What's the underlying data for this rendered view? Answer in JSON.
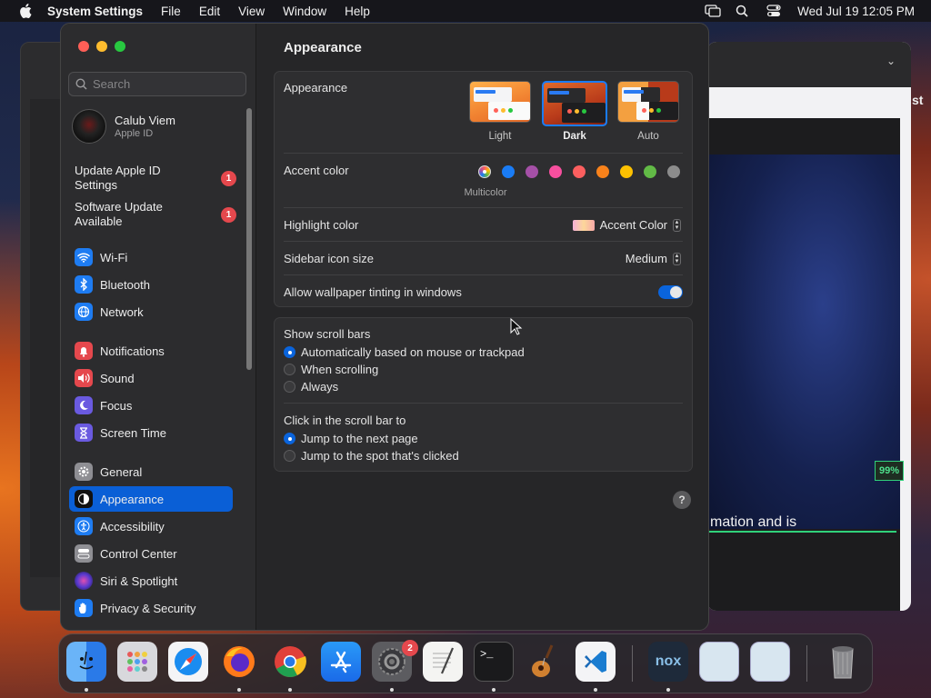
{
  "menubar": {
    "app": "System Settings",
    "menus": [
      "File",
      "Edit",
      "View",
      "Window",
      "Help"
    ],
    "datetime": "Wed Jul 19  12:05 PM"
  },
  "background": {
    "progress_label": "99%",
    "progress": 0.99,
    "partial_text": "mation and is",
    "corner_text": "st"
  },
  "sidebar": {
    "search_placeholder": "Search",
    "profile": {
      "name": "Calub Viem",
      "sub": "Apple ID"
    },
    "notices": [
      {
        "label": "Update Apple ID Settings",
        "badge": "1"
      },
      {
        "label": "Software Update Available",
        "badge": "1"
      }
    ],
    "items": [
      {
        "label": "Wi-Fi",
        "icon": "wifi-icon",
        "color": "#1e7cf2"
      },
      {
        "label": "Bluetooth",
        "icon": "bluetooth-icon",
        "color": "#1e7cf2"
      },
      {
        "label": "Network",
        "icon": "globe-icon",
        "color": "#1e7cf2"
      },
      {
        "label": "Notifications",
        "icon": "bell-icon",
        "color": "#e5484d"
      },
      {
        "label": "Sound",
        "icon": "speaker-icon",
        "color": "#e5484d"
      },
      {
        "label": "Focus",
        "icon": "moon-icon",
        "color": "#6a5ae0"
      },
      {
        "label": "Screen Time",
        "icon": "hourglass-icon",
        "color": "#6a5ae0"
      },
      {
        "label": "General",
        "icon": "gear-icon",
        "color": "#8e8e93"
      },
      {
        "label": "Appearance",
        "icon": "appearance-icon",
        "color": "#111111",
        "selected": true
      },
      {
        "label": "Accessibility",
        "icon": "accessibility-icon",
        "color": "#1e7cf2"
      },
      {
        "label": "Control Center",
        "icon": "control-center-icon",
        "color": "#8e8e93"
      },
      {
        "label": "Siri & Spotlight",
        "icon": "siri-icon",
        "color": "#3a2a6a"
      },
      {
        "label": "Privacy & Security",
        "icon": "hand-icon",
        "color": "#1e7cf2"
      }
    ]
  },
  "content": {
    "title": "Appearance",
    "appearance": {
      "label": "Appearance",
      "options": [
        {
          "label": "Light",
          "selected": false
        },
        {
          "label": "Dark",
          "selected": true
        },
        {
          "label": "Auto",
          "selected": false
        }
      ]
    },
    "accent": {
      "label": "Accent color",
      "caption": "Multicolor",
      "colors": [
        "multicolor",
        "#1a7cf5",
        "#a550a7",
        "#f74f9e",
        "#fc5f5f",
        "#f8821b",
        "#fdc101",
        "#62ba46",
        "#8c8c8c"
      ],
      "selected": "multicolor"
    },
    "highlight": {
      "label": "Highlight color",
      "value": "Accent Color"
    },
    "icon_size": {
      "label": "Sidebar icon size",
      "value": "Medium"
    },
    "tinting": {
      "label": "Allow wallpaper tinting in windows",
      "on": true
    },
    "scroll_bars": {
      "label": "Show scroll bars",
      "options": [
        {
          "label": "Automatically based on mouse or trackpad",
          "selected": true
        },
        {
          "label": "When scrolling",
          "selected": false
        },
        {
          "label": "Always",
          "selected": false
        }
      ]
    },
    "click_scroll": {
      "label": "Click in the scroll bar to",
      "options": [
        {
          "label": "Jump to the next page",
          "selected": true
        },
        {
          "label": "Jump to the spot that's clicked",
          "selected": false
        }
      ]
    },
    "help": "?"
  },
  "dock": {
    "apps": [
      "Finder",
      "Launchpad",
      "Safari",
      "Firefox",
      "Chrome",
      "App Store",
      "System Settings",
      "TextEdit",
      "Terminal",
      "GarageBand",
      "Visual Studio Code",
      "Nox",
      "Preview",
      "Preview",
      "Trash"
    ],
    "settings_badge": "2"
  }
}
